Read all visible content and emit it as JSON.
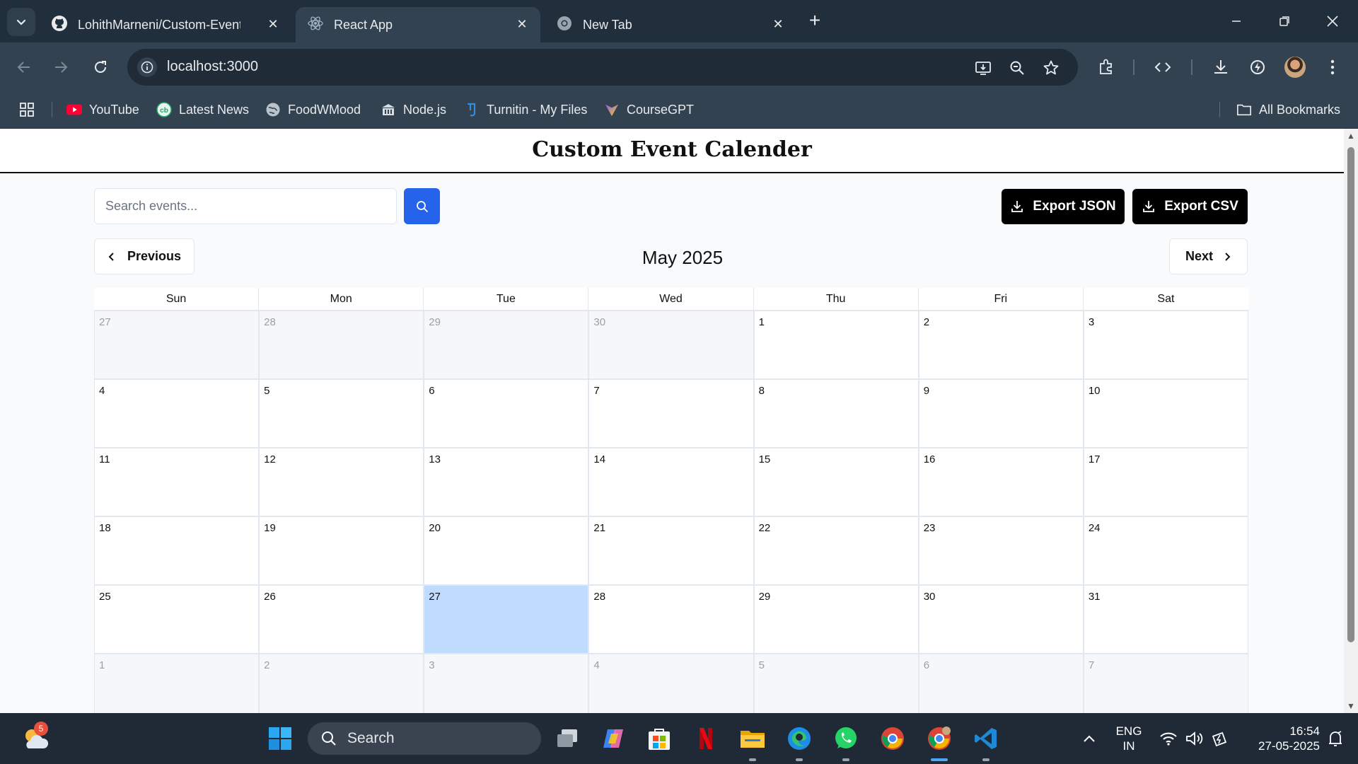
{
  "browser": {
    "tabs": [
      {
        "title": "LohithMarneni/Custom-Event-Ca",
        "icon": "github-icon",
        "active": false
      },
      {
        "title": "React App",
        "icon": "react-icon",
        "active": true
      },
      {
        "title": "New Tab",
        "icon": "chrome-icon",
        "active": false
      }
    ],
    "url": "localhost:3000",
    "bookmarks": [
      {
        "label": "YouTube",
        "icon": "youtube-icon"
      },
      {
        "label": "Latest News",
        "icon": "news-icon"
      },
      {
        "label": "FoodWMood",
        "icon": "globe-icon"
      },
      {
        "label": "Node.js",
        "icon": "building-icon"
      },
      {
        "label": "Turnitin - My Files",
        "icon": "turnitin-icon"
      },
      {
        "label": "CourseGPT",
        "icon": "coursegpt-icon"
      }
    ],
    "all_bookmarks_label": "All Bookmarks"
  },
  "app": {
    "title": "Custom Event Calender",
    "search": {
      "placeholder": "Search events..."
    },
    "export_json_label": "Export JSON",
    "export_csv_label": "Export CSV",
    "prev_label": "Previous",
    "next_label": "Next",
    "month_label": "May 2025",
    "weekdays": [
      "Sun",
      "Mon",
      "Tue",
      "Wed",
      "Thu",
      "Fri",
      "Sat"
    ],
    "days": [
      {
        "d": "27",
        "other": true
      },
      {
        "d": "28",
        "other": true
      },
      {
        "d": "29",
        "other": true
      },
      {
        "d": "30",
        "other": true
      },
      {
        "d": "1"
      },
      {
        "d": "2"
      },
      {
        "d": "3"
      },
      {
        "d": "4"
      },
      {
        "d": "5"
      },
      {
        "d": "6"
      },
      {
        "d": "7"
      },
      {
        "d": "8"
      },
      {
        "d": "9"
      },
      {
        "d": "10"
      },
      {
        "d": "11"
      },
      {
        "d": "12"
      },
      {
        "d": "13"
      },
      {
        "d": "14"
      },
      {
        "d": "15"
      },
      {
        "d": "16"
      },
      {
        "d": "17"
      },
      {
        "d": "18"
      },
      {
        "d": "19"
      },
      {
        "d": "20"
      },
      {
        "d": "21"
      },
      {
        "d": "22"
      },
      {
        "d": "23"
      },
      {
        "d": "24"
      },
      {
        "d": "25"
      },
      {
        "d": "26"
      },
      {
        "d": "27",
        "today": true
      },
      {
        "d": "28"
      },
      {
        "d": "29"
      },
      {
        "d": "30"
      },
      {
        "d": "31"
      },
      {
        "d": "1",
        "other": true
      },
      {
        "d": "2",
        "other": true
      },
      {
        "d": "3",
        "other": true
      },
      {
        "d": "4",
        "other": true
      },
      {
        "d": "5",
        "other": true
      },
      {
        "d": "6",
        "other": true
      },
      {
        "d": "7",
        "other": true
      }
    ],
    "colors": {
      "accent": "#2563eb",
      "today": "#bfdbfe",
      "export_bg": "#000000"
    }
  },
  "taskbar": {
    "weather_badge": "5",
    "search_label": "Search",
    "lang_line1": "ENG",
    "lang_line2": "IN",
    "time": "16:54",
    "date": "27-05-2025"
  }
}
